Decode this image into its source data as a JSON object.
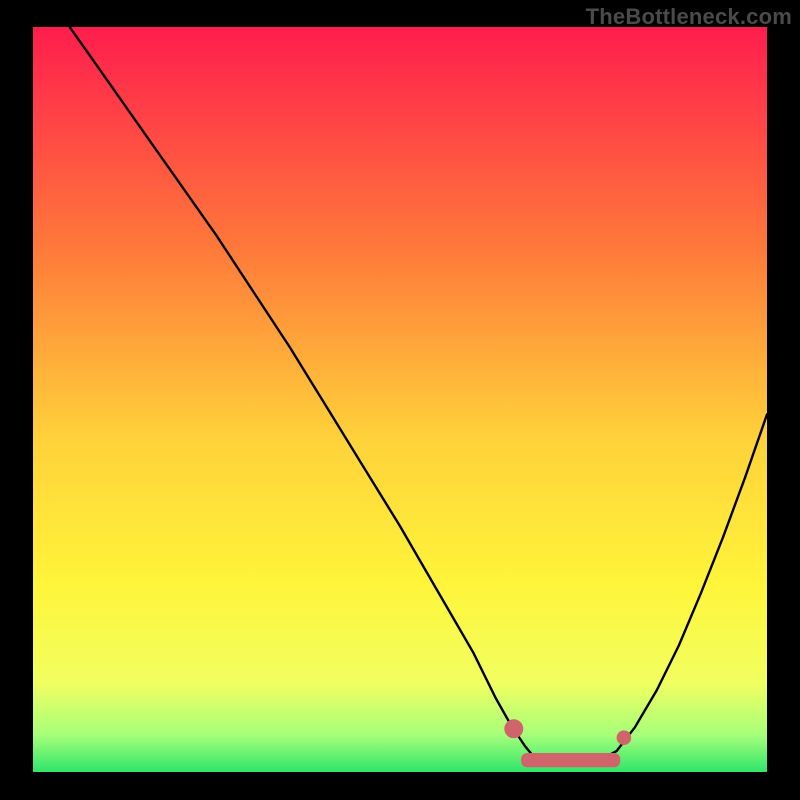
{
  "watermark": "TheBottleneck.com",
  "colors": {
    "gradient_top": "#ff1d4d",
    "gradient_mid_upper": "#ff7a3a",
    "gradient_mid": "#ffd13a",
    "gradient_mid_lower": "#fff53a",
    "gradient_low": "#f1ff60",
    "gradient_bottom_a": "#a7ff7a",
    "gradient_bottom_b": "#2fe56a",
    "curve": "#000000",
    "marker_fill": "#d1636b",
    "marker_stroke": "#d1636b"
  },
  "chart_data": {
    "type": "line",
    "title": "",
    "xlabel": "",
    "ylabel": "",
    "xlim": [
      0,
      100
    ],
    "ylim": [
      0,
      100
    ],
    "series": [
      {
        "name": "bottleneck-curve-left",
        "x": [
          5,
          10,
          15,
          20,
          25,
          30,
          35,
          40,
          45,
          50,
          55,
          60,
          63,
          65,
          67,
          68.5
        ],
        "values": [
          100,
          93,
          86,
          79,
          72,
          64.5,
          57,
          49,
          41,
          33,
          24.5,
          16,
          10,
          6.5,
          3.5,
          1.7
        ]
      },
      {
        "name": "bottleneck-flat",
        "x": [
          68.5,
          70,
          72,
          74,
          76,
          78,
          79.5
        ],
        "values": [
          1.7,
          1.4,
          1.3,
          1.3,
          1.5,
          2.0,
          2.8
        ]
      },
      {
        "name": "bottleneck-curve-right",
        "x": [
          79.5,
          82,
          85,
          88,
          91,
          94,
          97,
          100
        ],
        "values": [
          2.8,
          6,
          11,
          17,
          24,
          31.5,
          39.5,
          48
        ]
      }
    ],
    "markers": [
      {
        "name": "left-marker",
        "x": 65.5,
        "y": 5.8,
        "r": 1.3
      },
      {
        "name": "right-marker",
        "x": 80.5,
        "y": 4.6,
        "r": 1.0
      }
    ],
    "flat_band": {
      "x0": 66.5,
      "x1": 80.0,
      "y": 1.6,
      "thickness": 1.9
    }
  }
}
